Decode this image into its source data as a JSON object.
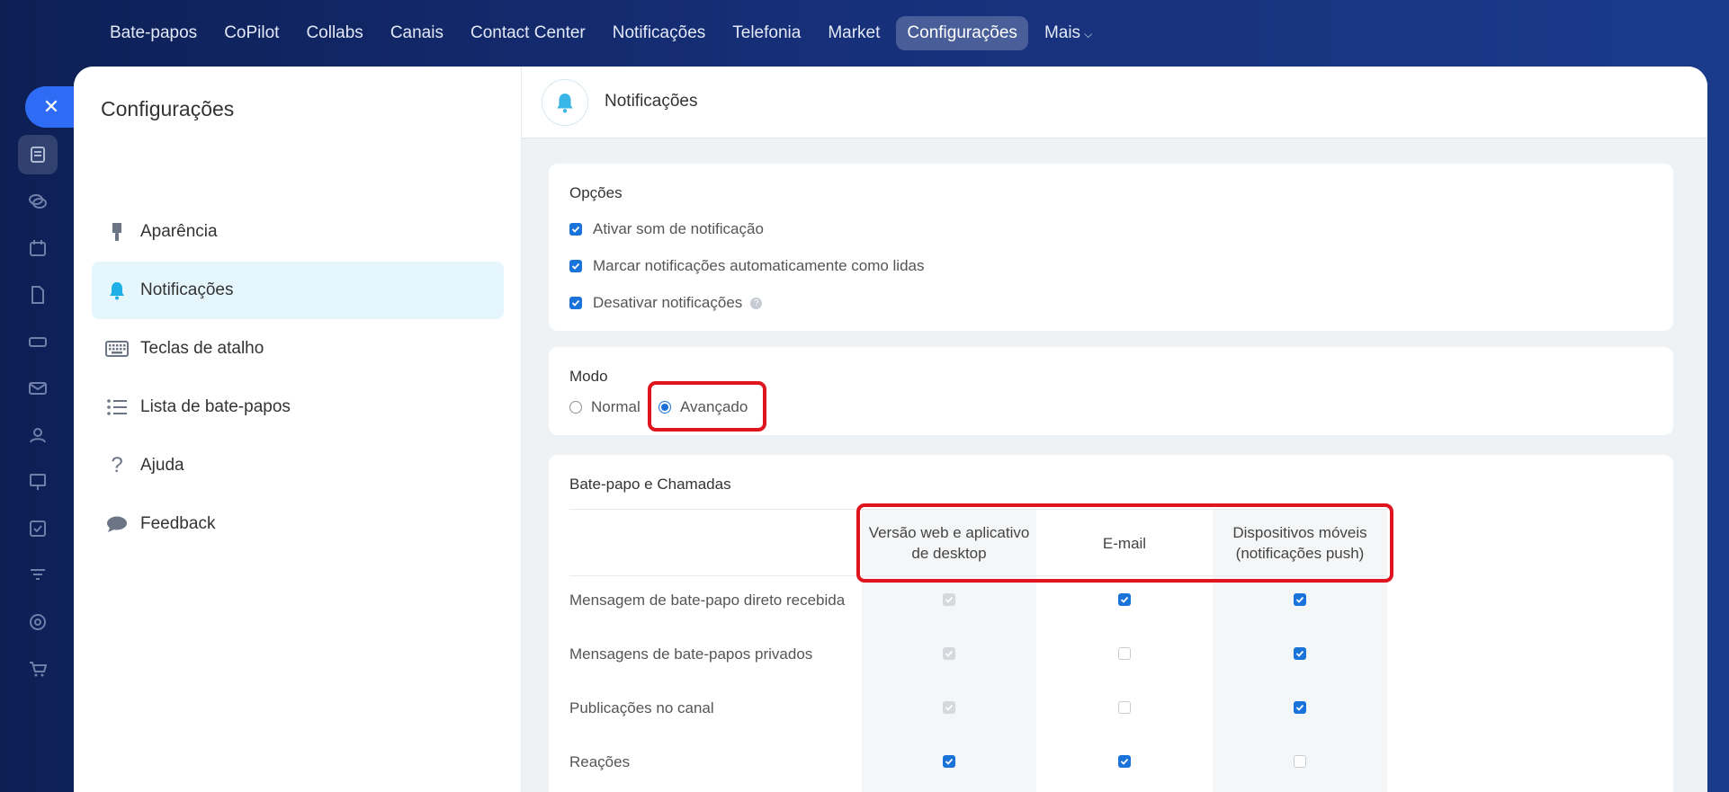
{
  "topnav": {
    "items": [
      "Bate-papos",
      "CoPilot",
      "Collabs",
      "Canais",
      "Contact Center",
      "Notificações",
      "Telefonia",
      "Market",
      "Configurações"
    ],
    "more_label": "Mais"
  },
  "sidebar": {
    "title": "Configurações",
    "items": [
      {
        "label": "Aparência",
        "icon": "brush-icon"
      },
      {
        "label": "Notificações",
        "icon": "bell-icon"
      },
      {
        "label": "Teclas de atalho",
        "icon": "keyboard-icon"
      },
      {
        "label": "Lista de bate-papos",
        "icon": "list-icon"
      },
      {
        "label": "Ajuda",
        "icon": "question-icon"
      },
      {
        "label": "Feedback",
        "icon": "chat-bubble-icon"
      }
    ]
  },
  "content": {
    "title": "Notificações",
    "options": {
      "title": "Opções",
      "items": [
        {
          "label": "Ativar som de notificação",
          "checked": true
        },
        {
          "label": "Marcar notificações automaticamente como lidas",
          "checked": true
        },
        {
          "label": "Desativar notificações",
          "checked": true
        }
      ]
    },
    "mode": {
      "title": "Modo",
      "normal_label": "Normal",
      "advanced_label": "Avançado",
      "selected": "Avançado"
    },
    "chat": {
      "title": "Bate-papo e Chamadas",
      "columns": [
        "Versão web e aplicativo de desktop",
        "E-mail",
        "Dispositivos móveis (notificações push)"
      ],
      "rows": [
        {
          "label": "Mensagem de bate-papo direto recebida",
          "values": [
            "disabled",
            "on",
            "on"
          ]
        },
        {
          "label": "Mensagens de bate-papos privados",
          "values": [
            "disabled",
            "off",
            "on"
          ]
        },
        {
          "label": "Publicações no canal",
          "values": [
            "disabled",
            "off",
            "on"
          ]
        },
        {
          "label": "Reações",
          "values": [
            "on",
            "on",
            "off"
          ]
        }
      ]
    }
  },
  "colors": {
    "accent": "#1a73d9",
    "highlight": "#e0141e",
    "active_menu_bg": "#e5f6fd"
  }
}
